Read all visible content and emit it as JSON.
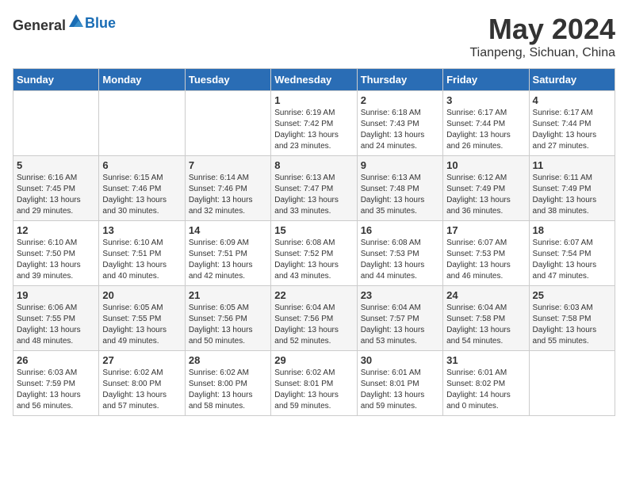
{
  "header": {
    "logo_general": "General",
    "logo_blue": "Blue",
    "month_year": "May 2024",
    "location": "Tianpeng, Sichuan, China"
  },
  "calendar": {
    "days_of_week": [
      "Sunday",
      "Monday",
      "Tuesday",
      "Wednesday",
      "Thursday",
      "Friday",
      "Saturday"
    ],
    "weeks": [
      [
        {
          "day": "",
          "info": ""
        },
        {
          "day": "",
          "info": ""
        },
        {
          "day": "",
          "info": ""
        },
        {
          "day": "1",
          "info": "Sunrise: 6:19 AM\nSunset: 7:42 PM\nDaylight: 13 hours\nand 23 minutes."
        },
        {
          "day": "2",
          "info": "Sunrise: 6:18 AM\nSunset: 7:43 PM\nDaylight: 13 hours\nand 24 minutes."
        },
        {
          "day": "3",
          "info": "Sunrise: 6:17 AM\nSunset: 7:44 PM\nDaylight: 13 hours\nand 26 minutes."
        },
        {
          "day": "4",
          "info": "Sunrise: 6:17 AM\nSunset: 7:44 PM\nDaylight: 13 hours\nand 27 minutes."
        }
      ],
      [
        {
          "day": "5",
          "info": "Sunrise: 6:16 AM\nSunset: 7:45 PM\nDaylight: 13 hours\nand 29 minutes."
        },
        {
          "day": "6",
          "info": "Sunrise: 6:15 AM\nSunset: 7:46 PM\nDaylight: 13 hours\nand 30 minutes."
        },
        {
          "day": "7",
          "info": "Sunrise: 6:14 AM\nSunset: 7:46 PM\nDaylight: 13 hours\nand 32 minutes."
        },
        {
          "day": "8",
          "info": "Sunrise: 6:13 AM\nSunset: 7:47 PM\nDaylight: 13 hours\nand 33 minutes."
        },
        {
          "day": "9",
          "info": "Sunrise: 6:13 AM\nSunset: 7:48 PM\nDaylight: 13 hours\nand 35 minutes."
        },
        {
          "day": "10",
          "info": "Sunrise: 6:12 AM\nSunset: 7:49 PM\nDaylight: 13 hours\nand 36 minutes."
        },
        {
          "day": "11",
          "info": "Sunrise: 6:11 AM\nSunset: 7:49 PM\nDaylight: 13 hours\nand 38 minutes."
        }
      ],
      [
        {
          "day": "12",
          "info": "Sunrise: 6:10 AM\nSunset: 7:50 PM\nDaylight: 13 hours\nand 39 minutes."
        },
        {
          "day": "13",
          "info": "Sunrise: 6:10 AM\nSunset: 7:51 PM\nDaylight: 13 hours\nand 40 minutes."
        },
        {
          "day": "14",
          "info": "Sunrise: 6:09 AM\nSunset: 7:51 PM\nDaylight: 13 hours\nand 42 minutes."
        },
        {
          "day": "15",
          "info": "Sunrise: 6:08 AM\nSunset: 7:52 PM\nDaylight: 13 hours\nand 43 minutes."
        },
        {
          "day": "16",
          "info": "Sunrise: 6:08 AM\nSunset: 7:53 PM\nDaylight: 13 hours\nand 44 minutes."
        },
        {
          "day": "17",
          "info": "Sunrise: 6:07 AM\nSunset: 7:53 PM\nDaylight: 13 hours\nand 46 minutes."
        },
        {
          "day": "18",
          "info": "Sunrise: 6:07 AM\nSunset: 7:54 PM\nDaylight: 13 hours\nand 47 minutes."
        }
      ],
      [
        {
          "day": "19",
          "info": "Sunrise: 6:06 AM\nSunset: 7:55 PM\nDaylight: 13 hours\nand 48 minutes."
        },
        {
          "day": "20",
          "info": "Sunrise: 6:05 AM\nSunset: 7:55 PM\nDaylight: 13 hours\nand 49 minutes."
        },
        {
          "day": "21",
          "info": "Sunrise: 6:05 AM\nSunset: 7:56 PM\nDaylight: 13 hours\nand 50 minutes."
        },
        {
          "day": "22",
          "info": "Sunrise: 6:04 AM\nSunset: 7:56 PM\nDaylight: 13 hours\nand 52 minutes."
        },
        {
          "day": "23",
          "info": "Sunrise: 6:04 AM\nSunset: 7:57 PM\nDaylight: 13 hours\nand 53 minutes."
        },
        {
          "day": "24",
          "info": "Sunrise: 6:04 AM\nSunset: 7:58 PM\nDaylight: 13 hours\nand 54 minutes."
        },
        {
          "day": "25",
          "info": "Sunrise: 6:03 AM\nSunset: 7:58 PM\nDaylight: 13 hours\nand 55 minutes."
        }
      ],
      [
        {
          "day": "26",
          "info": "Sunrise: 6:03 AM\nSunset: 7:59 PM\nDaylight: 13 hours\nand 56 minutes."
        },
        {
          "day": "27",
          "info": "Sunrise: 6:02 AM\nSunset: 8:00 PM\nDaylight: 13 hours\nand 57 minutes."
        },
        {
          "day": "28",
          "info": "Sunrise: 6:02 AM\nSunset: 8:00 PM\nDaylight: 13 hours\nand 58 minutes."
        },
        {
          "day": "29",
          "info": "Sunrise: 6:02 AM\nSunset: 8:01 PM\nDaylight: 13 hours\nand 59 minutes."
        },
        {
          "day": "30",
          "info": "Sunrise: 6:01 AM\nSunset: 8:01 PM\nDaylight: 13 hours\nand 59 minutes."
        },
        {
          "day": "31",
          "info": "Sunrise: 6:01 AM\nSunset: 8:02 PM\nDaylight: 14 hours\nand 0 minutes."
        },
        {
          "day": "",
          "info": ""
        }
      ]
    ]
  }
}
